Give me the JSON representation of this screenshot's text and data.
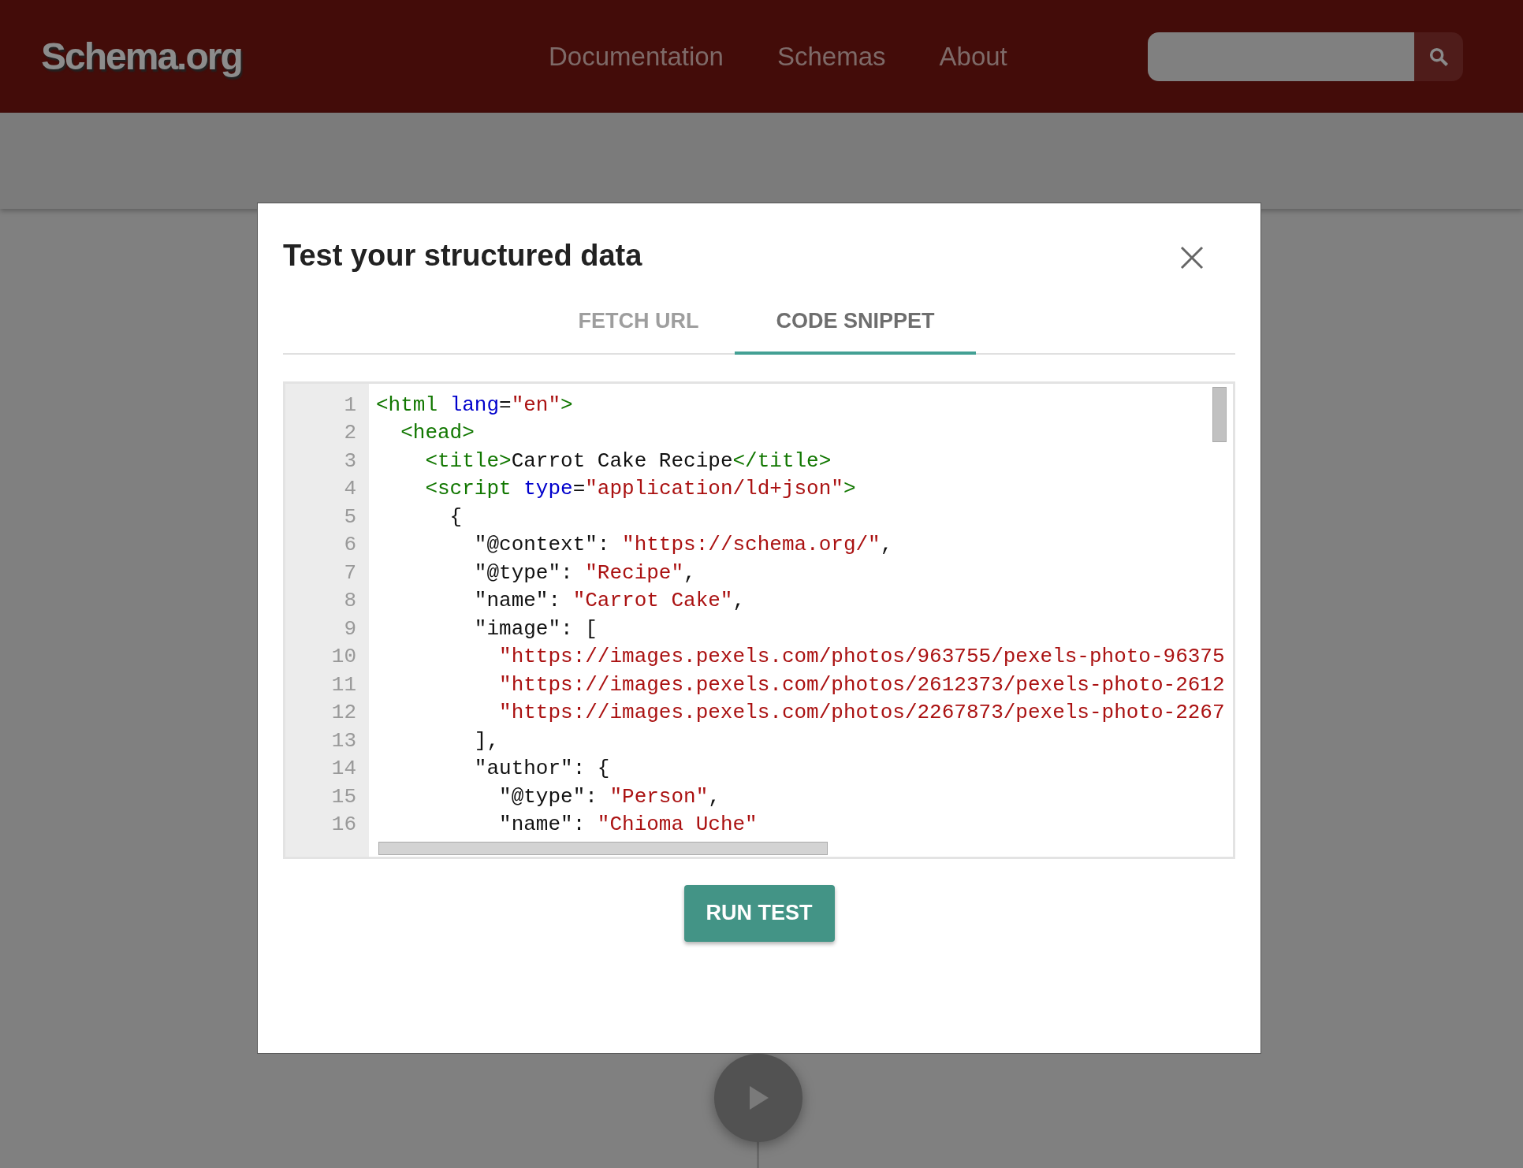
{
  "header": {
    "logo": "Schema.org",
    "nav": [
      "Documentation",
      "Schemas",
      "About"
    ]
  },
  "dialog": {
    "title": "Test your structured data",
    "tabs": [
      {
        "label": "FETCH URL",
        "selected": false
      },
      {
        "label": "CODE SNIPPET",
        "selected": true
      }
    ],
    "editor": {
      "lines": [
        {
          "number": "1",
          "tokens": [
            {
              "kind": "tag",
              "text": "<html "
            },
            {
              "kind": "attr",
              "text": "lang"
            },
            {
              "kind": "plain",
              "text": "="
            },
            {
              "kind": "string",
              "text": "\"en\""
            },
            {
              "kind": "tag",
              "text": ">"
            }
          ]
        },
        {
          "number": "2",
          "tokens": [
            {
              "kind": "tag",
              "text": "  <head>"
            }
          ]
        },
        {
          "number": "3",
          "tokens": [
            {
              "kind": "tag",
              "text": "    <title>"
            },
            {
              "kind": "plain",
              "text": "Carrot Cake Recipe"
            },
            {
              "kind": "tag",
              "text": "</title>"
            }
          ]
        },
        {
          "number": "4",
          "tokens": [
            {
              "kind": "tag",
              "text": "    <script "
            },
            {
              "kind": "attr",
              "text": "type"
            },
            {
              "kind": "plain",
              "text": "="
            },
            {
              "kind": "string",
              "text": "\"application/ld+json\""
            },
            {
              "kind": "tag",
              "text": ">"
            }
          ]
        },
        {
          "number": "5",
          "tokens": [
            {
              "kind": "plain",
              "text": "      {"
            }
          ]
        },
        {
          "number": "6",
          "tokens": [
            {
              "kind": "plain",
              "text": "        \"@context\": "
            },
            {
              "kind": "string",
              "text": "\"https://schema.org/\""
            },
            {
              "kind": "plain",
              "text": ","
            }
          ]
        },
        {
          "number": "7",
          "tokens": [
            {
              "kind": "plain",
              "text": "        \"@type\": "
            },
            {
              "kind": "string",
              "text": "\"Recipe\""
            },
            {
              "kind": "plain",
              "text": ","
            }
          ]
        },
        {
          "number": "8",
          "tokens": [
            {
              "kind": "plain",
              "text": "        \"name\": "
            },
            {
              "kind": "string",
              "text": "\"Carrot Cake\""
            },
            {
              "kind": "plain",
              "text": ","
            }
          ]
        },
        {
          "number": "9",
          "tokens": [
            {
              "kind": "plain",
              "text": "        \"image\": ["
            }
          ]
        },
        {
          "number": "10",
          "tokens": [
            {
              "kind": "string",
              "text": "          \"https://images.pexels.com/photos/963755/pexels-photo-96375"
            }
          ]
        },
        {
          "number": "11",
          "tokens": [
            {
              "kind": "string",
              "text": "          \"https://images.pexels.com/photos/2612373/pexels-photo-2612"
            }
          ]
        },
        {
          "number": "12",
          "tokens": [
            {
              "kind": "string",
              "text": "          \"https://images.pexels.com/photos/2267873/pexels-photo-2267"
            }
          ]
        },
        {
          "number": "13",
          "tokens": [
            {
              "kind": "plain",
              "text": "        ],"
            }
          ]
        },
        {
          "number": "14",
          "tokens": [
            {
              "kind": "plain",
              "text": "        \"author\": {"
            }
          ]
        },
        {
          "number": "15",
          "tokens": [
            {
              "kind": "plain",
              "text": "          \"@type\": "
            },
            {
              "kind": "string",
              "text": "\"Person\""
            },
            {
              "kind": "plain",
              "text": ","
            }
          ]
        },
        {
          "number": "16",
          "tokens": [
            {
              "kind": "plain",
              "text": "          \"name\": "
            },
            {
              "kind": "string",
              "text": "\"Chioma Uche\""
            }
          ]
        }
      ]
    },
    "button": "RUN TEST"
  }
}
